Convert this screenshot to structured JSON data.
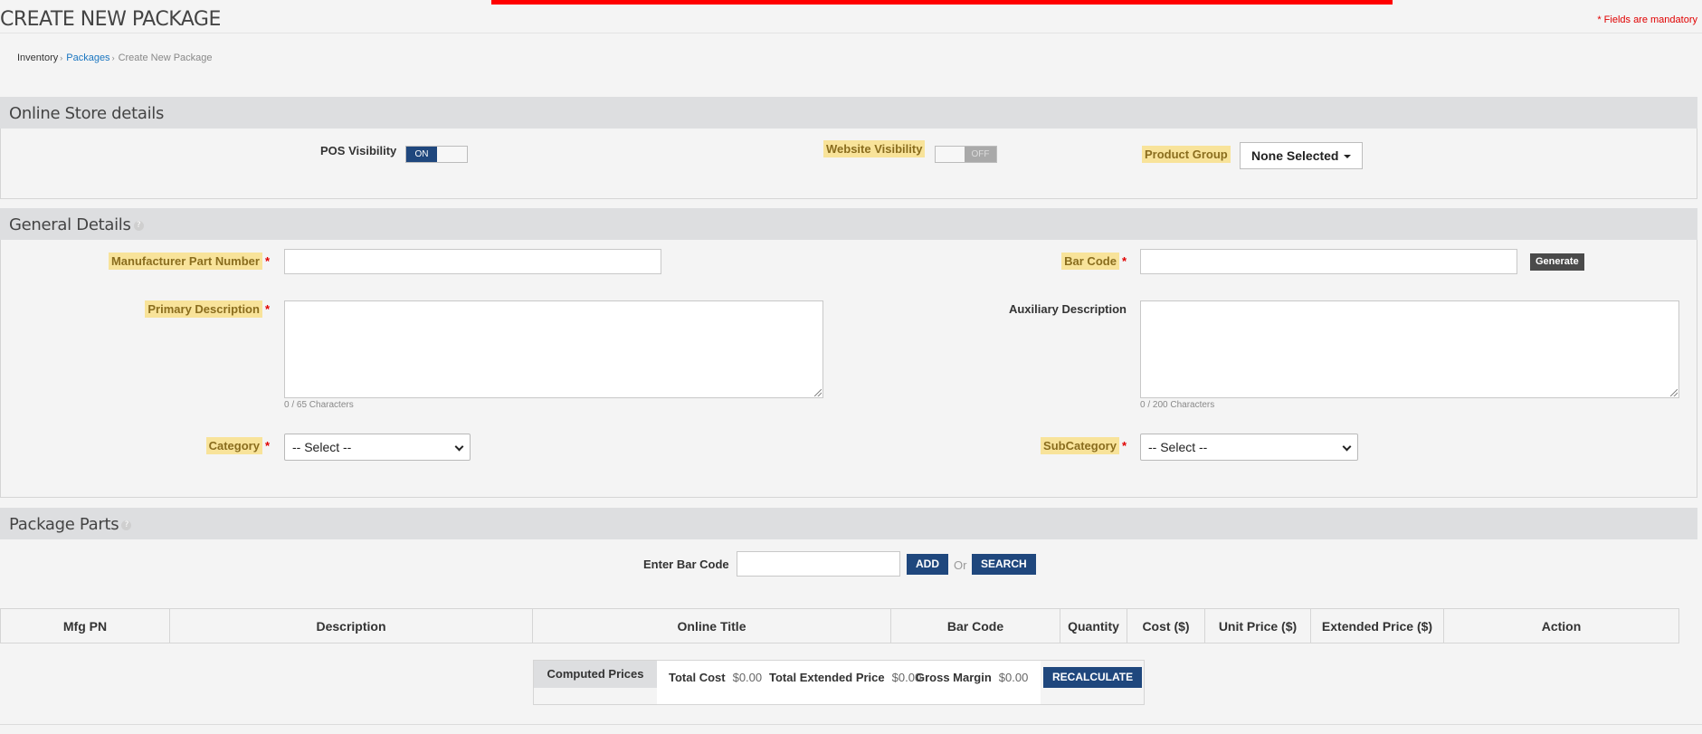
{
  "page": {
    "title": "CREATE NEW PACKAGE",
    "mandatory_note": "* Fields are mandatory"
  },
  "breadcrumb": {
    "inventory": "Inventory",
    "packages": "Packages",
    "current": "Create New Package",
    "separator": "›"
  },
  "online_store": {
    "title": "Online Store details",
    "pos_visibility": {
      "label": "POS Visibility",
      "state": "ON"
    },
    "website_visibility": {
      "label": "Website Visibility",
      "state": "OFF"
    },
    "product_group": {
      "label": "Product Group",
      "value": "None Selected"
    }
  },
  "general": {
    "title": "General Details",
    "info_icon": "question-circle-icon",
    "mfg_part_number": {
      "label": "Manufacturer Part Number",
      "value": ""
    },
    "bar_code": {
      "label": "Bar Code",
      "value": "",
      "generate_label": "Generate"
    },
    "primary_description": {
      "label": "Primary Description",
      "value": "",
      "counter": "0 / 65 Characters"
    },
    "auxiliary_description": {
      "label": "Auxiliary Description",
      "value": "",
      "counter": "0 / 200 Characters"
    },
    "category": {
      "label": "Category",
      "value": "-- Select --"
    },
    "subcategory": {
      "label": "SubCategory",
      "value": "-- Select --"
    },
    "required_mark": "*"
  },
  "package_parts": {
    "title": "Package Parts",
    "bar_code_label": "Enter Bar Code",
    "bar_code_value": "",
    "add_label": "ADD",
    "or_label": "Or",
    "search_label": "SEARCH",
    "columns": [
      "Mfg PN",
      "Description",
      "Online Title",
      "Bar Code",
      "Quantity",
      "Cost ($)",
      "Unit Price ($)",
      "Extended Price ($)",
      "Action"
    ]
  },
  "computed_prices": {
    "label": "Computed Prices",
    "total_cost_label": "Total Cost",
    "total_cost": "$0.00",
    "total_extended_label": "Total Extended Price",
    "total_extended": "$0.00",
    "gross_margin_label": "Gross Margin",
    "gross_margin": "$0.00",
    "recalculate_label": "RECALCULATE"
  },
  "colors": {
    "accent_blue": "#1f477d",
    "required_red": "#e00000",
    "highlight": "#f8e39a",
    "link": "#1a76c0"
  }
}
